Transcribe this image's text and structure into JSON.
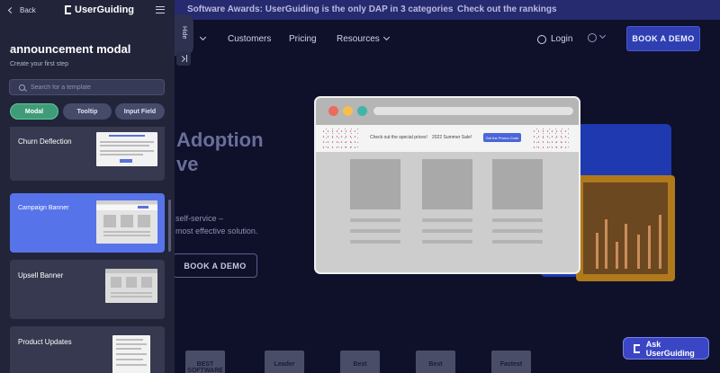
{
  "site": {
    "announcement_text": "Software Awards: UserGuiding is the only DAP in 3 categories",
    "announcement_link": "Check out the rankings",
    "nav": {
      "customers": "Customers",
      "pricing": "Pricing",
      "resources": "Resources",
      "login": "Login",
      "book_demo": "BOOK A DEMO"
    },
    "hero": {
      "title_line1": "Adoption",
      "title_line2": "ve",
      "subtitle_line1": "self-service –",
      "subtitle_line2": "most effective solution.",
      "cta": "BOOK A DEMO"
    },
    "badges": [
      "BEST SOFTWARE",
      "Leader",
      "Best",
      "Best",
      "Fastest"
    ]
  },
  "preview_modal": {
    "banner_text": "Check out the special prices!",
    "banner_sale": "2022 Summer Sale!",
    "banner_button": "Get the Promo Code"
  },
  "sidebar": {
    "back_label": "Back",
    "logo_text": "UserGuiding",
    "title": "announcement modal",
    "subtitle": "Create your first step",
    "search_placeholder": "Search for a template",
    "filters": [
      "Modal",
      "Tooltip",
      "Input Field"
    ],
    "active_filter": "Modal",
    "templates": [
      {
        "label": "Churn Deflection",
        "active": false
      },
      {
        "label": "Campaign Banner",
        "active": true
      },
      {
        "label": "Upsell Banner",
        "active": false
      },
      {
        "label": "Product Updates",
        "active": false
      }
    ],
    "hide_label": "Hide"
  },
  "ask_button": "Ask UserGuiding",
  "colors": {
    "sidebar_bg": "#22243a",
    "active_template": "#5673ea",
    "active_filter": "#3f9c78",
    "brand_blue": "#2f3fb2"
  }
}
